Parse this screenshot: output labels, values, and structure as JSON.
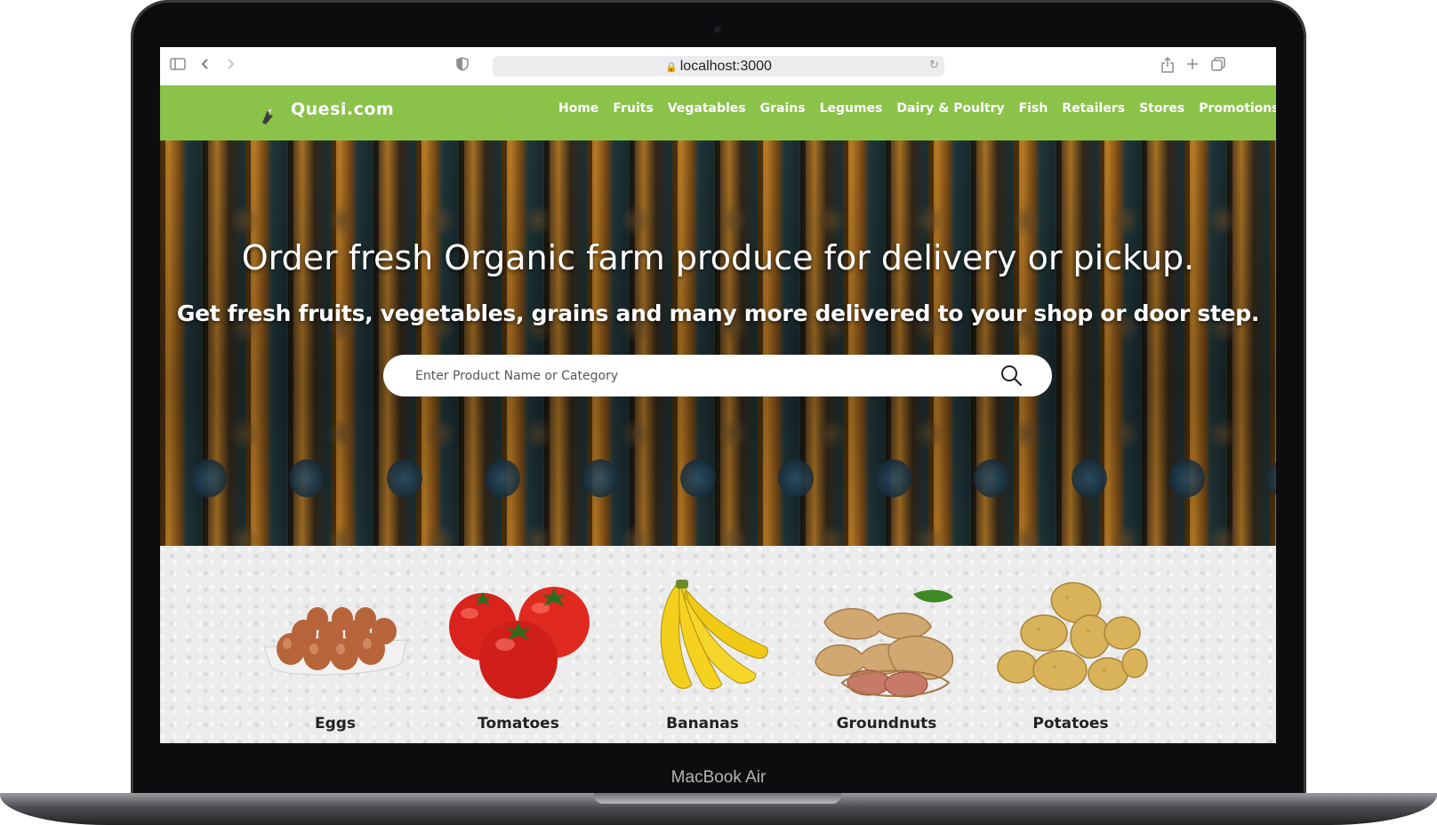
{
  "device": {
    "label": "MacBook Air"
  },
  "browser": {
    "url": "localhost:3000",
    "icons": [
      "sidebar-icon",
      "back-icon",
      "forward-icon",
      "shield-icon",
      "lock-icon",
      "reload-icon",
      "share-icon",
      "new-tab-icon",
      "tabs-icon"
    ]
  },
  "site": {
    "logo_text": "Quesi.com",
    "nav": [
      "Home",
      "Fruits",
      "Vegatables",
      "Grains",
      "Legumes",
      "Dairy & Poultry",
      "Fish",
      "Retailers",
      "Stores",
      "Promotions"
    ],
    "accent_color": "#8bc34a"
  },
  "hero": {
    "title": "Order fresh Organic farm produce for delivery or pickup.",
    "subtitle": "Get fresh fruits, vegetables, grains and many more delivered to your shop or door step.",
    "search_placeholder": "Enter Product Name or Category"
  },
  "products": [
    {
      "name": "Eggs",
      "icon": "eggs-image"
    },
    {
      "name": "Tomatoes",
      "icon": "tomatoes-image"
    },
    {
      "name": "Bananas",
      "icon": "bananas-image"
    },
    {
      "name": "Groundnuts",
      "icon": "groundnuts-image"
    },
    {
      "name": "Potatoes",
      "icon": "potatoes-image"
    }
  ]
}
